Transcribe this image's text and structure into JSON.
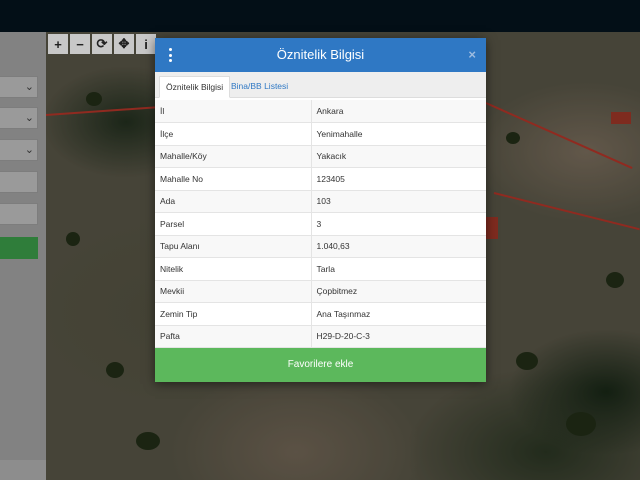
{
  "toolbar": {
    "zoom_in": "+",
    "zoom_out": "−",
    "refresh": "⟳",
    "locate": "✥",
    "info": "i"
  },
  "left_panel": {
    "chevron": "⌄"
  },
  "modal": {
    "title": "Öznitelik Bilgisi",
    "close": "×",
    "tabs": [
      "Öznitelik Bilgisi",
      "Bina/BB Listesi"
    ],
    "rows": [
      {
        "key": "İl",
        "value": "Ankara"
      },
      {
        "key": "İlçe",
        "value": "Yenimahalle"
      },
      {
        "key": "Mahalle/Köy",
        "value": "Yakacık"
      },
      {
        "key": "Mahalle No",
        "value": "123405"
      },
      {
        "key": "Ada",
        "value": "103"
      },
      {
        "key": "Parsel",
        "value": "3"
      },
      {
        "key": "Tapu Alanı",
        "value": "1.040,63"
      },
      {
        "key": "Nitelik",
        "value": "Tarla"
      },
      {
        "key": "Mevkii",
        "value": "Çopbitmez"
      },
      {
        "key": "Zemin Tip",
        "value": "Ana Taşınmaz"
      },
      {
        "key": "Pafta",
        "value": "H29-D-20-C-3"
      }
    ],
    "favorite_button": "Favorilere ekle"
  },
  "colors": {
    "header_blue": "#2f78c4",
    "favorite_green": "#5cb85c",
    "parcel_line_red": "#c0392b"
  }
}
